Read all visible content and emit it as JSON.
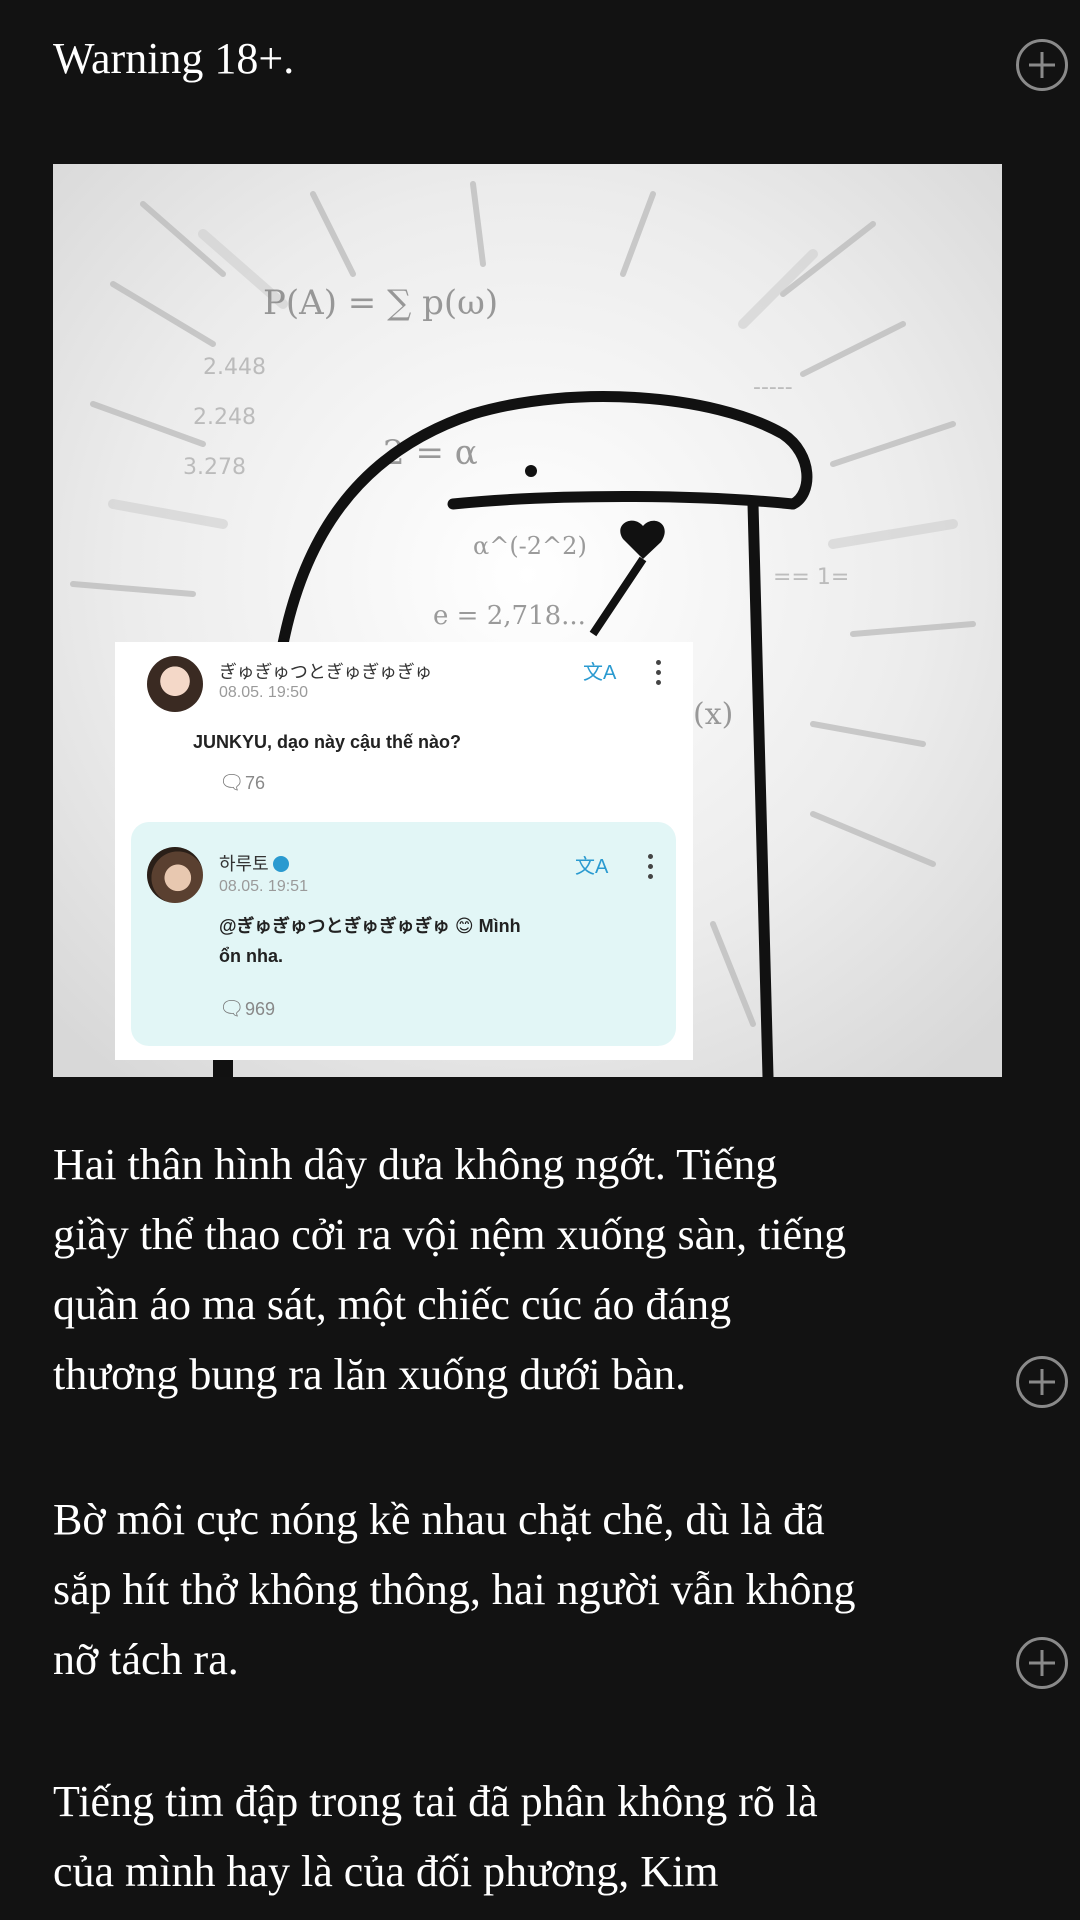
{
  "article": {
    "warning": "Warning 18+.",
    "paragraphs": [
      {
        "lines": [
          "Hai thân hình dây dưa không ngớt. Tiếng",
          "giầy thể thao cởi ra vội nệm xuống sàn, tiếng",
          "quần áo ma sát, một chiếc cúc áo đáng",
          "thương bung ra lăn xuống dưới bàn."
        ]
      },
      {
        "lines": [
          "Bờ môi cực nóng kề nhau chặt chẽ, dù là đã",
          "sắp hít thở không thông, hai người vẫn không",
          "nỡ tách ra."
        ]
      },
      {
        "lines": [
          "Tiếng tim đập trong tai đã phân không rõ là",
          "của mình hay là của đối phương, Kim"
        ]
      }
    ]
  },
  "meme_image": {
    "scribbles": [
      "P(A) = ∑ p(ω)",
      "2 = α",
      "e = 2,718...",
      "α^(-2^2)",
      "(x)"
    ],
    "post": {
      "username": "ぎゅぎゅつとぎゅぎゅぎゅ",
      "time": "08.05. 19:50",
      "text": "JUNKYU, dạo này cậu thế nào?",
      "comment_count": "76",
      "translate_icon": "translate-icon"
    },
    "reply": {
      "username": "하루토",
      "time": "08.05. 19:51",
      "text_line1": "@ぎゅぎゅつとぎゅぎゅぎゅ",
      "text_line1_tail": "Mình",
      "text_line2": "ổn nha.",
      "comment_count": "969"
    }
  },
  "colors": {
    "background": "#121212",
    "text": "#ffffff",
    "add_icon": "#8a8a8a",
    "reply_bg": "#e2f6f6",
    "accent_blue": "#2a9ad0"
  }
}
